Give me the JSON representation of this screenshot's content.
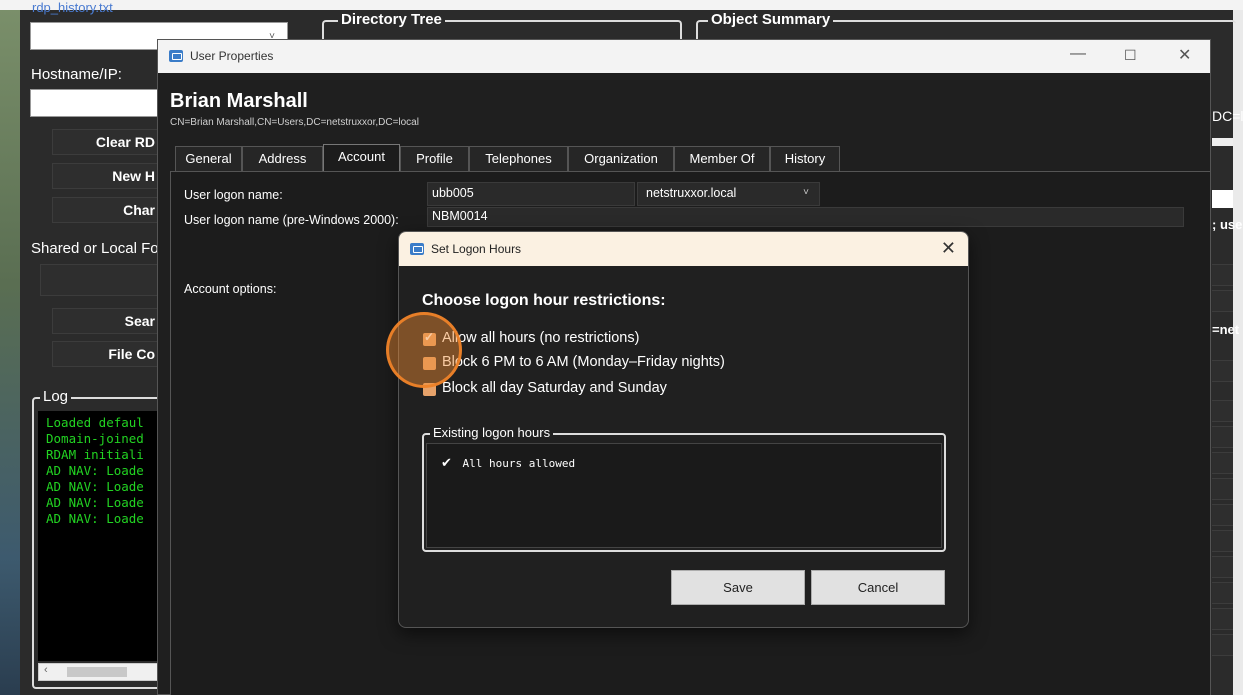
{
  "main": {
    "file_label": "rdp_history.txt",
    "hostname_label": "Hostname/IP:",
    "buttons": [
      "Clear RD",
      "New H",
      "Char",
      "Sear",
      "File Co"
    ],
    "shared_label": "Shared or Local Fo",
    "directory_tree_label": "Directory Tree",
    "object_summary_label": "Object Summary",
    "log_label": "Log",
    "log_lines": [
      "Loaded defaul",
      "Domain-joined",
      "RDAM initiali",
      "AD NAV: Loade",
      "AD NAV: Loade",
      "AD NAV: Loade",
      "AD NAV: Loade"
    ],
    "right_snippets": [
      "DC=lo",
      "; use",
      "=net"
    ]
  },
  "user_properties": {
    "window_title": "User Properties",
    "user_name": "Brian Marshall",
    "dn": "CN=Brian Marshall,CN=Users,DC=netstruxxor,DC=local",
    "tabs": [
      "General",
      "Address",
      "Account",
      "Profile",
      "Telephones",
      "Organization",
      "Member Of",
      "History"
    ],
    "active_tab": "Account",
    "logon_name_label": "User logon name:",
    "logon_name_value": "ubb005",
    "domain_value": "netstruxxor.local",
    "pre2000_label": "User logon name (pre-Windows 2000):",
    "pre2000_value": "NBM0014",
    "account_options_label": "Account options:"
  },
  "logon_hours": {
    "window_title": "Set Logon Hours",
    "heading": "Choose logon hour restrictions:",
    "options": [
      {
        "label": "Allow all hours (no restrictions)",
        "checked": true
      },
      {
        "label": "Block 6 PM to 6 AM (Monday–Friday nights)",
        "checked": false
      },
      {
        "label": "Block all day Saturday and Sunday",
        "checked": false
      }
    ],
    "existing_label": "Existing logon hours",
    "existing_value": "All hours allowed",
    "save_label": "Save",
    "cancel_label": "Cancel"
  },
  "colors": {
    "accent": "#e6a26a",
    "log_text": "#22d322",
    "title_bar_modal": "#fbf1e2"
  }
}
